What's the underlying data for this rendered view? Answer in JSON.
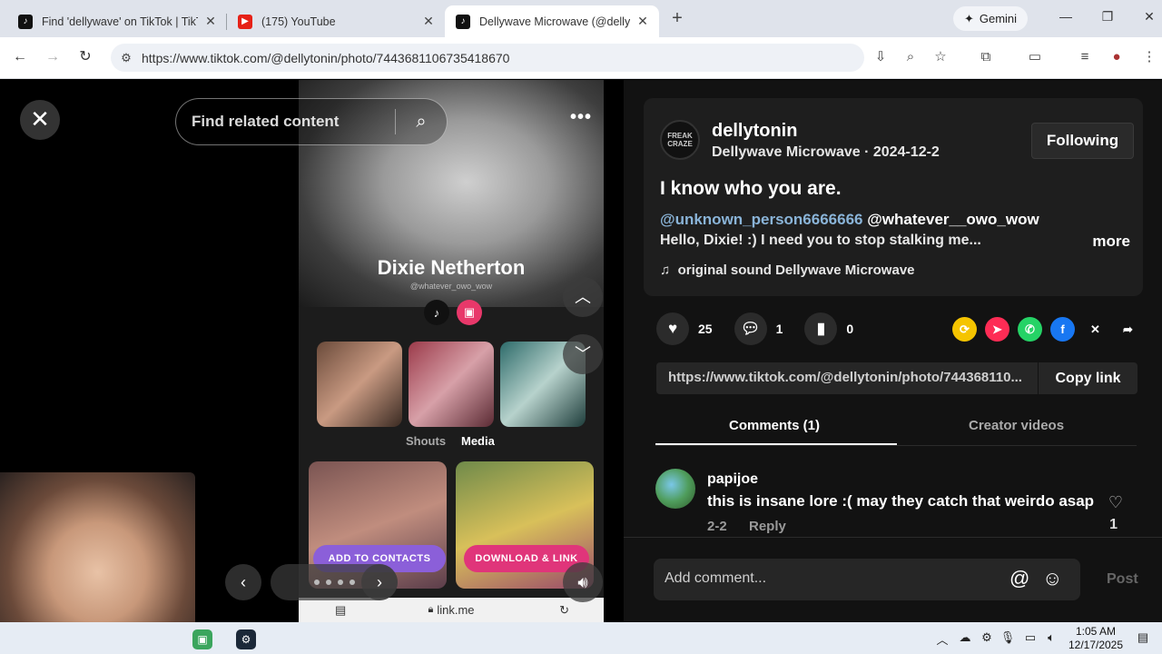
{
  "browser": {
    "tabs": [
      {
        "title": "Find 'dellywave' on TikTok | TikT",
        "icon": "tiktok-icon"
      },
      {
        "title": "(175) YouTube",
        "icon": "youtube-icon"
      },
      {
        "title": "Dellywave Microwave (@dellyto",
        "icon": "tiktok-icon"
      }
    ],
    "new_tab": "+",
    "gemini_label": "Gemini",
    "url": "https://www.tiktok.com/@dellytonin/photo/7443681106735418670"
  },
  "media": {
    "search_placeholder": "Find related content",
    "profile_name": "Dixie Netherton",
    "profile_handle": "@whatever_owo_wow",
    "tab_shouts": "Shouts",
    "tab_media": "Media",
    "btn_contacts": "ADD TO CONTACTS",
    "btn_download": "DOWNLOAD & LINK",
    "link_domain": "link.me"
  },
  "post": {
    "username": "dellytonin",
    "display_name": "Dellywave Microwave",
    "date": "2024-12-2",
    "follow_label": "Following",
    "caption": "I know who you are.",
    "mention_1": "@unknown_person6666666",
    "mention_2": "@whatever__owo_wow",
    "description": "Hello, Dixie! :) I need you to stop stalking me...",
    "more_label": "more",
    "sound": "original sound Dellywave Microwave",
    "likes": "25",
    "comments": "1",
    "saves": "0",
    "share_url": "https://www.tiktok.com/@dellytonin/photo/744368110...",
    "copy_label": "Copy link",
    "tab_comments": "Comments (1)",
    "tab_creator": "Creator videos"
  },
  "comment": {
    "user": "papijoe",
    "text": "this is insane lore :( may they catch that weirdo asap",
    "date": "2-2",
    "reply_label": "Reply",
    "likes": "1"
  },
  "composer": {
    "placeholder": "Add comment...",
    "post_label": "Post"
  },
  "taskbar": {
    "time": "1:05 AM",
    "date": "12/17/2025"
  }
}
